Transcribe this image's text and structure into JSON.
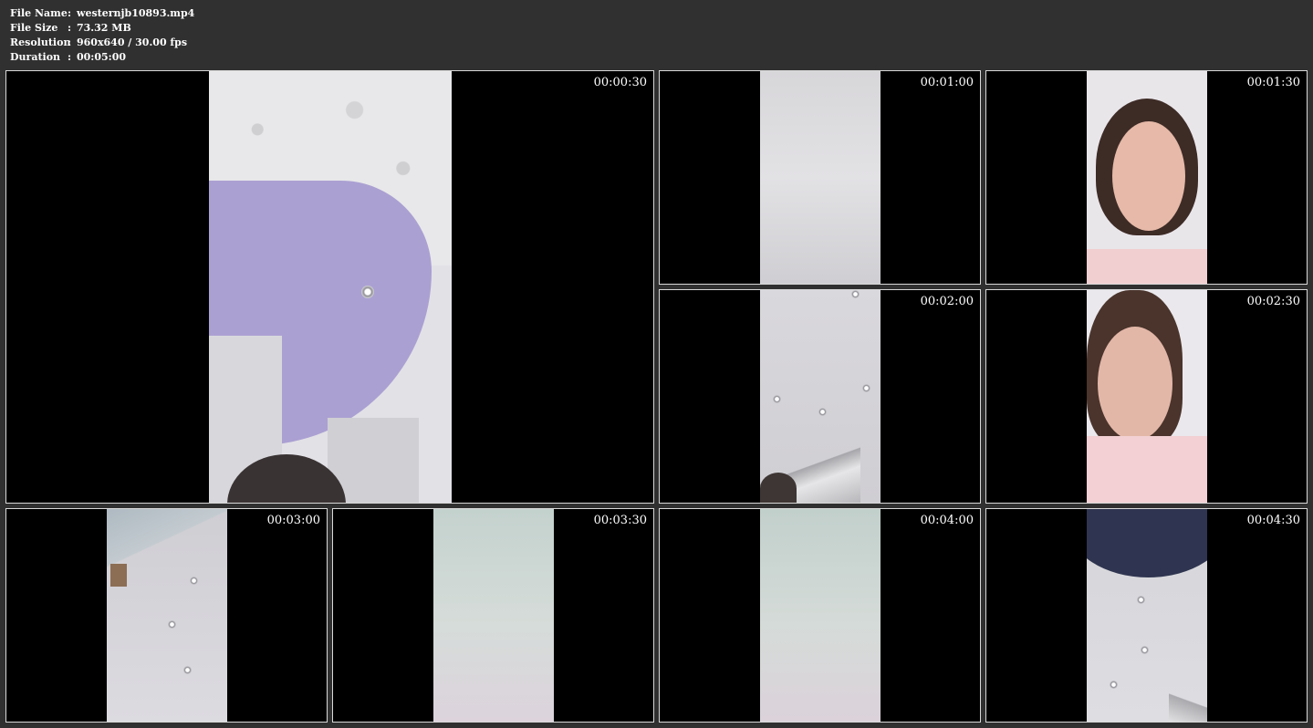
{
  "info": {
    "file_name_label": "File Name",
    "file_name": "westernjb10893.mp4",
    "file_size_label": "File Size",
    "file_size": "73.32 MB",
    "resolution_label": "Resolution",
    "resolution": "960x640 / 30.00 fps",
    "duration_label": "Duration",
    "duration": "00:05:00",
    "separator": ":"
  },
  "thumbnails": [
    {
      "timestamp": "00:00:30"
    },
    {
      "timestamp": "00:01:00"
    },
    {
      "timestamp": "00:01:30"
    },
    {
      "timestamp": "00:02:00"
    },
    {
      "timestamp": "00:02:30"
    },
    {
      "timestamp": "00:03:00"
    },
    {
      "timestamp": "00:03:30"
    },
    {
      "timestamp": "00:04:00"
    },
    {
      "timestamp": "00:04:30"
    }
  ],
  "colors": {
    "background": "#303030",
    "frame_border": "#d9d9d9",
    "letterbox": "#000000",
    "text": "#ffffff"
  }
}
